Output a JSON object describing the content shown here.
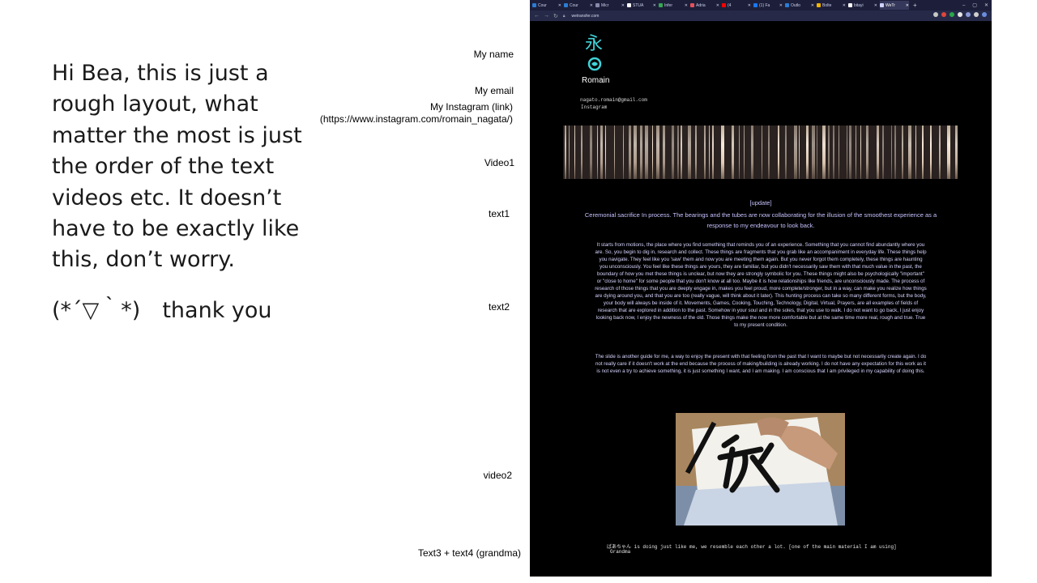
{
  "note": {
    "body": "Hi Bea, this is just a rough layout, what matter the most is just the order of the text videos etc. It doesn’t have to be exactly like this, don’t worry.",
    "thanks": "(*´▽｀*)　thank you"
  },
  "labels": {
    "name": "My name",
    "email": "My email",
    "instagram": "My Instagram (link)",
    "instagram_url": "(https://www.instagram.com/romain_nagata/)",
    "video1": "Video1",
    "text1": "text1",
    "text2": "text2",
    "video2": "video2",
    "text34": "Text3 + text4 (grandma)"
  },
  "browser": {
    "tabs": [
      {
        "label": "Cour",
        "icon": "outlook-icon",
        "color": "#2b7cd3"
      },
      {
        "label": "Cour",
        "icon": "outlook-icon",
        "color": "#2b7cd3"
      },
      {
        "label": "Micr",
        "icon": "globe-icon",
        "color": "#8888aa"
      },
      {
        "label": "STUA",
        "icon": "dots-icon",
        "color": "#ffffff"
      },
      {
        "label": "Infer",
        "icon": "drive-icon",
        "color": "#34a853"
      },
      {
        "label": "Adria",
        "icon": "t-icon",
        "color": "#e8505b"
      },
      {
        "label": "(4",
        "icon": "youtube-icon",
        "color": "#ff0000"
      },
      {
        "label": "(1) Fa",
        "icon": "facebook-icon",
        "color": "#1877f2"
      },
      {
        "label": "Outlo",
        "icon": "outlook-icon",
        "color": "#2b7cd3"
      },
      {
        "label": "Bolte",
        "icon": "b-icon",
        "color": "#f4b400"
      },
      {
        "label": "bitayi",
        "icon": "google-icon",
        "color": "#ffffff"
      },
      {
        "label": "WeTr",
        "icon": "wetransfer-icon",
        "color": "#cfd3ff",
        "active": true
      }
    ],
    "url": "wetransfer.com",
    "extension_colors": [
      "#c8c8c8",
      "#e0453a",
      "#2aa84a",
      "#e6e6e6",
      "#8a9ad8",
      "#d0d0d0",
      "#6a8de0"
    ]
  },
  "site": {
    "kanji": "永",
    "name": "Romain",
    "email": "nagato.romain@gmail.com",
    "instagram_link": "Instagram",
    "update": "[update]",
    "subhead": "Ceremonial sacrifice In process. The bearings and the tubes are now collaborating for the illusion of the smoothest experience as a response to my endeavour to look back.",
    "paragraph1": "It starts from motions, the place where you find something that reminds you of an experience. Something that you cannot find abundantly where you are. So, you begin to dig in, research and collect. These things are fragments that you grab like an accompaniment in everyday life. These things help you navigate. They feel like you 'saw' them and now you are meeting them again. But you never forgot them completely, these things are haunting you unconsciously. You feel like these things are yours, they are familiar, but you didn't necessarily saw them with that much value in the past, the boundary of how you met these things is unclear, but now they are strongly symbolic for you. These things might also be psychologically \"important\" or \"close to home\" for some people that you don't know at all too. Maybe it is how relationships like friends, are unconsciously made. The process of research of those things that you are deeply engage in, makes you feel proud, more complete/stronger, but in a way, can make you realize how things are dying around you, and that you are too (really vague, will think about it later). This hunting process can take so many different forms, but the body, your body will always be inside of it. Movements, Games, Cooking, Touching, Technology, Digital, Virtual, Prayers, are all examples of fields of research that are explored in addition to the past. Somehow in your soul and in the soles, that you use to walk. I do not want to go back, I just enjoy looking back now, I enjoy the newness of the old. Those things make the now more comfortable but at the same time more real, rough and true. True to my present condition.",
    "paragraph2": "The slide is another guide for me, a way to enjoy the present with that feeling from the past that I want to maybe but not necessarily create again. I do not really care if it doesn't work at the end because the process of making/building is already working. I do not have any expectation for this work as it is not even a try to achieve something, it is just something I want, and I am making. I am conscious that I am privileged in my capability of doing this.",
    "caption": "ばあちゃん is doing just like me, we resemble each other a lot. [one of the main material I am using]",
    "caption2": "Grandma"
  }
}
